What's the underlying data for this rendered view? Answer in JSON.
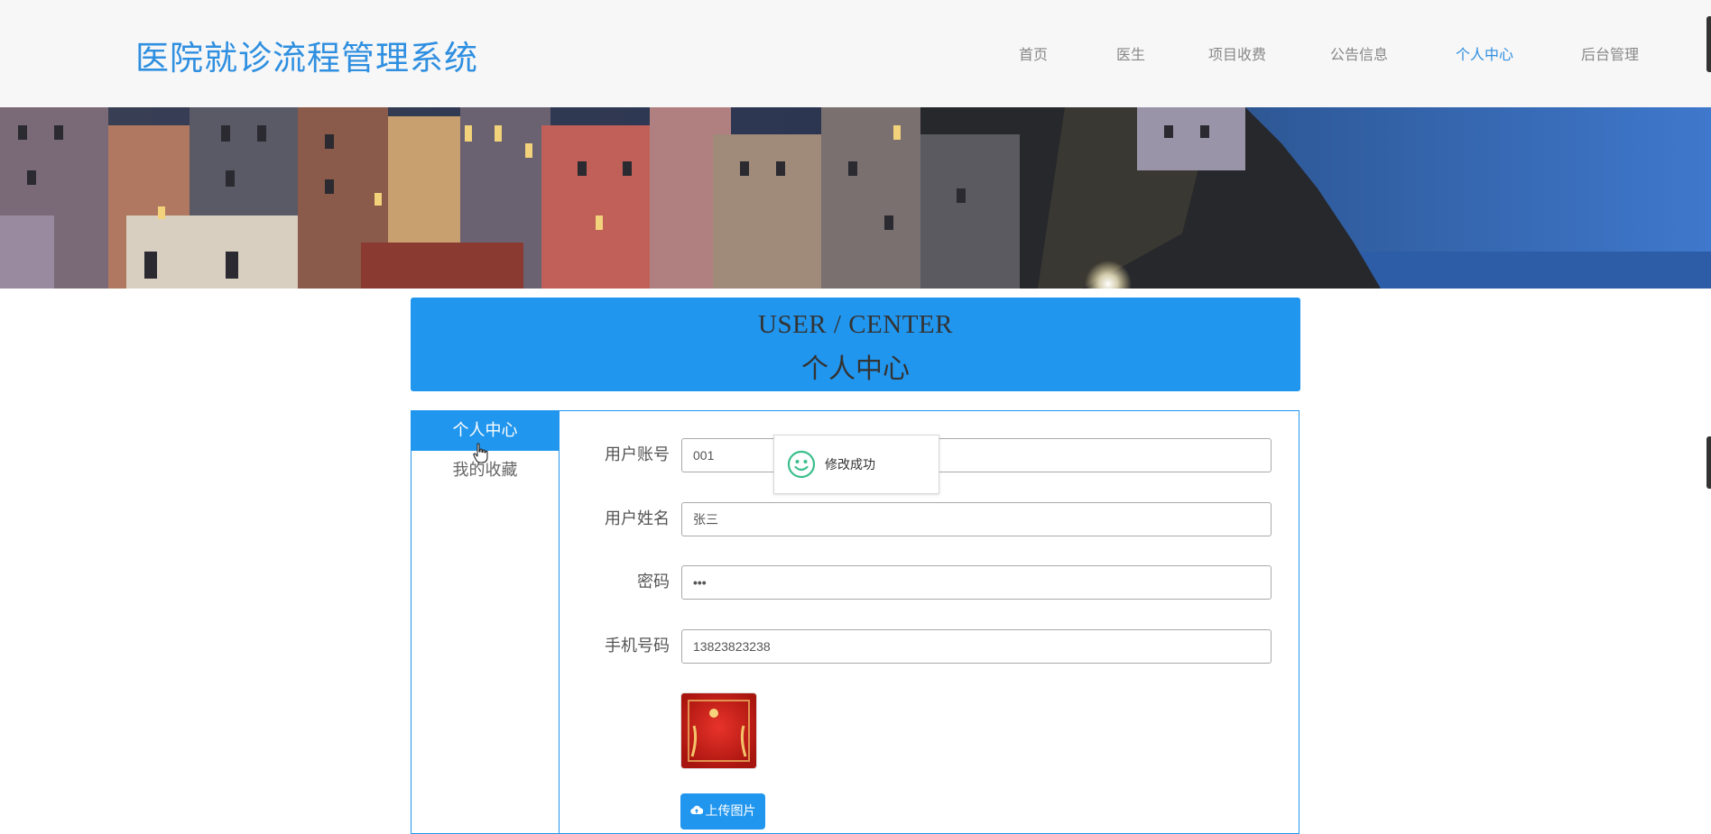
{
  "header": {
    "site_title": "医院就诊流程管理系统",
    "nav": [
      {
        "label": "首页",
        "active": false
      },
      {
        "label": "医生",
        "active": false
      },
      {
        "label": "项目收费",
        "active": false
      },
      {
        "label": "公告信息",
        "active": false
      },
      {
        "label": "个人中心",
        "active": true
      },
      {
        "label": "后台管理",
        "active": false
      }
    ]
  },
  "center_header": {
    "english": "USER / CENTER",
    "chinese": "个人中心"
  },
  "sidebar": {
    "items": [
      {
        "label": "个人中心",
        "active": true
      },
      {
        "label": "我的收藏",
        "active": false
      }
    ]
  },
  "form": {
    "fields": [
      {
        "label": "用户账号",
        "value": "001"
      },
      {
        "label": "用户姓名",
        "value": "张三"
      },
      {
        "label": "密码",
        "value": "•••"
      },
      {
        "label": "手机号码",
        "value": "13823823238"
      }
    ],
    "upload_label": "上传图片"
  },
  "toast": {
    "message": "修改成功"
  },
  "colors": {
    "accent": "#2196ee",
    "title": "#2f8fe0",
    "toast_icon": "#3bbf8c"
  },
  "icons": {
    "toast": "smile-icon",
    "upload": "cloud-upload-icon",
    "cursor": "hand-pointer-cursor"
  }
}
